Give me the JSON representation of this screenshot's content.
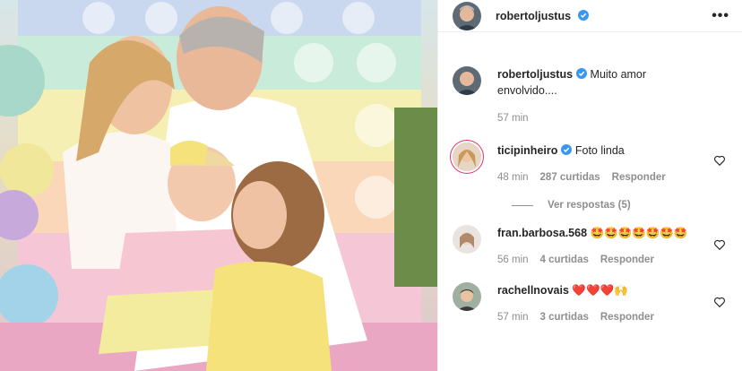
{
  "post": {
    "author": "robertoljustus",
    "caption": "Muito amor envolvido....",
    "caption_time": "57 min"
  },
  "header": {
    "more_label": "•••"
  },
  "comments": [
    {
      "user": "ticipinheiro",
      "verified": true,
      "text": "Foto linda",
      "time": "48 min",
      "likes": "287 curtidas",
      "reply": "Responder",
      "view_replies": "Ver respostas (5)"
    },
    {
      "user": "fran.barbosa.568",
      "verified": false,
      "text": "🤩🤩🤩🤩🤩🤩🤩",
      "time": "56 min",
      "likes": "4 curtidas",
      "reply": "Responder"
    },
    {
      "user": "rachellnovais",
      "verified": false,
      "text": "❤️❤️❤️🙌",
      "time": "57 min",
      "likes": "3 curtidas",
      "reply": "Responder"
    }
  ],
  "colors": {
    "verified": "#3897f0",
    "muted": "#8e8e8e",
    "text": "#262626"
  }
}
